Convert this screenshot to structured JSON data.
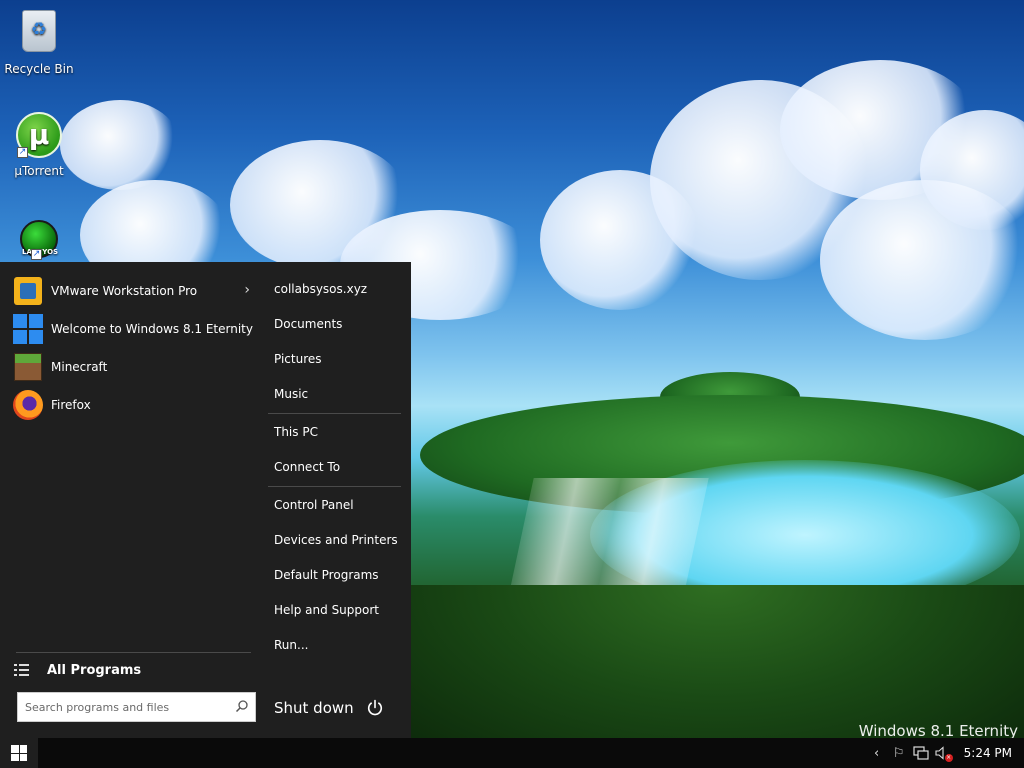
{
  "desktop": {
    "watermark": "Windows 8.1 Eternity",
    "icons": [
      {
        "label": "Recycle Bin",
        "icon": "recycle-bin-icon"
      },
      {
        "label": "µTorrent",
        "icon": "utorrent-icon",
        "glyph": "µ"
      },
      {
        "label": "",
        "icon": "labsyos-icon",
        "logo_text": "LABSYOS"
      }
    ]
  },
  "start_menu": {
    "programs": [
      {
        "label": "VMware Workstation Pro",
        "icon": "vmware-icon",
        "has_submenu": true,
        "arrow": "›"
      },
      {
        "label": "Welcome to Windows 8.1 Eternity",
        "icon": "windows-icon"
      },
      {
        "label": "Minecraft",
        "icon": "minecraft-icon"
      },
      {
        "label": "Firefox",
        "icon": "firefox-icon"
      }
    ],
    "all_programs": "All Programs",
    "search": {
      "placeholder": "Search programs and files",
      "value": ""
    },
    "places": [
      "collabsysos.xyz",
      "Documents",
      "Pictures",
      "Music",
      "This PC",
      "Connect To",
      "Control Panel",
      "Devices and Printers",
      "Default Programs",
      "Help and Support",
      "Run..."
    ],
    "shutdown": "Shut down",
    "colors": {
      "menu_bg": "#1f1f1f",
      "separator": "#4a4a4a"
    }
  },
  "taskbar": {
    "clock": "5:24 PM",
    "tray_icons": [
      "chevron-left-icon",
      "flag-icon",
      "network-icon",
      "volume-muted-icon"
    ],
    "chevron": "‹",
    "flag": "⚐",
    "mute_badge": "×"
  }
}
